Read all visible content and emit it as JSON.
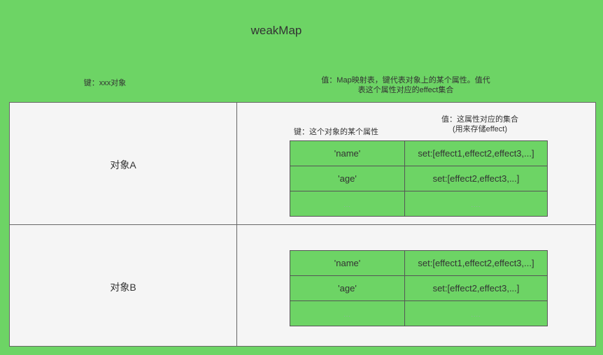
{
  "title": "weakMap",
  "header": {
    "key_label": "键：xxx对象",
    "value_label_line1": "值：Map映射表，键代表对象上的某个属性。值代",
    "value_label_line2": "表这个属性对应的effect集合"
  },
  "inner_header": {
    "key_label": "键：这个对象的某个属性",
    "value_label_line1": "值：这属性对应的集合",
    "value_label_line2": "(用来存储effect)"
  },
  "objects": [
    {
      "label": "对象A",
      "rows": [
        {
          "key": "'name'",
          "value": "set:[effect1,effect2,effect3,...]"
        },
        {
          "key": "'age'",
          "value": "set:[effect2,effect3,...]"
        },
        {
          "key": "...",
          "value": "...."
        }
      ]
    },
    {
      "label": "对象B",
      "rows": [
        {
          "key": "'name'",
          "value": "set:[effect1,effect2,effect3,...]"
        },
        {
          "key": "'age'",
          "value": "set:[effect2,effect3,...]"
        },
        {
          "key": "...",
          "value": "...."
        }
      ]
    }
  ]
}
